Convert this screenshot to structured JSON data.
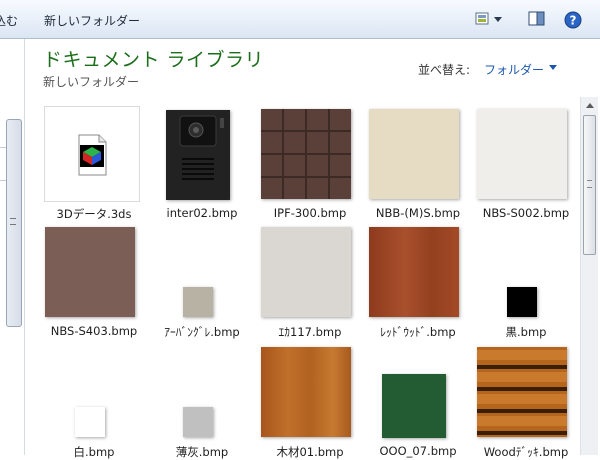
{
  "toolbar": {
    "cut_fragment": "込む",
    "new_folder_label": "新しいフォルダー"
  },
  "header": {
    "library_title": "ドキュメント ライブラリ",
    "subfolder": "新しいフォルダー",
    "arrange_label": "並べ替え:",
    "arrange_value": "フォルダー"
  },
  "files": [
    {
      "name": "3Dデータ.3ds",
      "kind": "3ds-file-icon"
    },
    {
      "name": "inter02.bmp",
      "kind": "intercom"
    },
    {
      "name": "IPF-300.bmp",
      "kind": "tile-grid"
    },
    {
      "name": "NBB-(M)S.bmp",
      "kind": "beige-texture"
    },
    {
      "name": "NBS-S002.bmp",
      "kind": "white-texture"
    },
    {
      "name": "NBS-S403.bmp",
      "kind": "brown-texture"
    },
    {
      "name": "ｱｰﾊﾞﾝｸﾞﾚ.bmp",
      "kind": "small-swatch"
    },
    {
      "name": "ｴｶ117.bmp",
      "kind": "gray-texture"
    },
    {
      "name": "ﾚｯﾄﾞｳｯﾄﾞ.bmp",
      "kind": "redwood"
    },
    {
      "name": "黒.bmp",
      "kind": "small-swatch"
    },
    {
      "name": "白.bmp",
      "kind": "small-swatch"
    },
    {
      "name": "薄灰.bmp",
      "kind": "small-swatch"
    },
    {
      "name": "木材01.bmp",
      "kind": "wood"
    },
    {
      "name": "OOO_07.bmp",
      "kind": "green-swatch"
    },
    {
      "name": "Woodﾃﾞｯｷ.bmp",
      "kind": "wood-deck"
    }
  ],
  "colors": {
    "library_title": "#1a6e1a",
    "arrange_value": "#1c58b0",
    "swatch_urban_gray": "#b8b2a4",
    "swatch_black": "#000000",
    "swatch_white": "#ffffff",
    "swatch_light_gray": "#c0c0c0",
    "swatch_green": "#235c32"
  }
}
